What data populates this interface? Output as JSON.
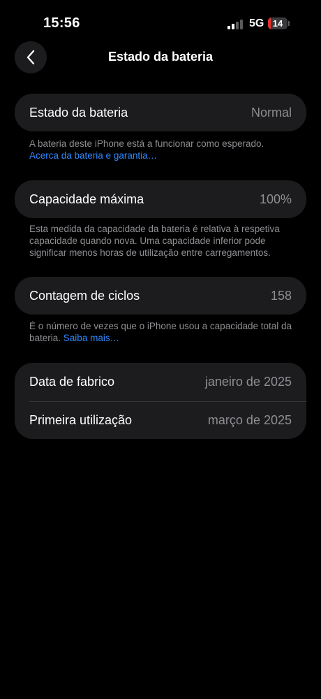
{
  "status_bar": {
    "time": "15:56",
    "network": "5G",
    "battery_level": "14"
  },
  "nav": {
    "back_icon": "chevron-left-icon",
    "title": "Estado da bateria"
  },
  "health": {
    "label": "Estado da bateria",
    "value": "Normal",
    "footnote": "A bateria deste iPhone está a funcionar como esperado.",
    "link": "Acerca da bateria e garantia…"
  },
  "capacity": {
    "label": "Capacidade máxima",
    "value": "100%",
    "footnote": "Esta medida da capacidade da bateria é relativa à respetiva capacidade quando nova. Uma capacidade inferior pode significar menos horas de utilização entre carregamentos."
  },
  "cycles": {
    "label": "Contagem de ciclos",
    "value": "158",
    "footnote": "É o número de vezes que o iPhone usou a capacidade total da bateria.",
    "link": "Saiba mais…"
  },
  "dates": {
    "manufacture_label": "Data de fabrico",
    "manufacture_value": "janeiro de 2025",
    "first_use_label": "Primeira utilização",
    "first_use_value": "março de 2025"
  },
  "colors": {
    "background": "#000000",
    "card": "#1c1c1e",
    "secondary_text": "#8e8e93",
    "link": "#2f88ff",
    "battery_low": "#e5312a"
  }
}
